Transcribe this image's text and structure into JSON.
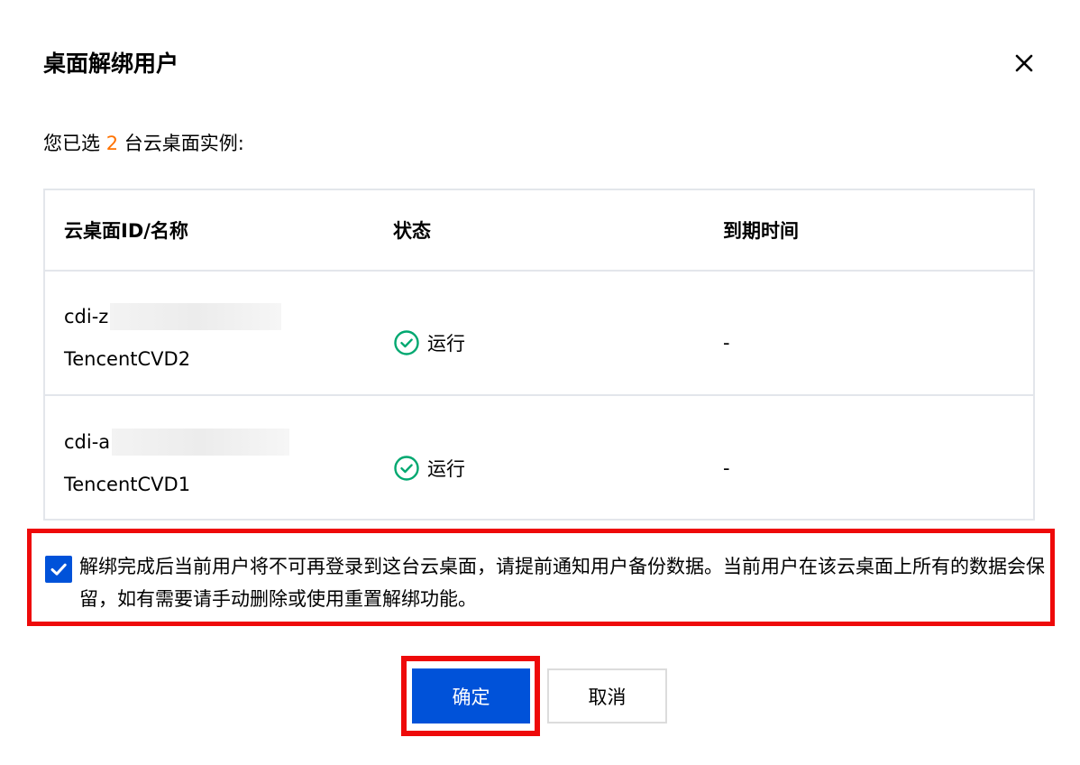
{
  "dialog": {
    "title": "桌面解绑用户",
    "close_icon": "close-icon"
  },
  "summary": {
    "prefix": "您已选 ",
    "count": "2",
    "suffix": " 台云桌面实例:",
    "count_color": "#ff7200"
  },
  "table": {
    "columns": [
      "云桌面ID/名称",
      "状态",
      "到期时间"
    ],
    "rows": [
      {
        "id_prefix": "cdi-z",
        "name": "TencentCVD2",
        "status": "运行",
        "status_icon": "check-circle-icon",
        "expire": "-"
      },
      {
        "id_prefix": "cdi-a",
        "name": "TencentCVD1",
        "status": "运行",
        "status_icon": "check-circle-icon",
        "expire": "-"
      }
    ]
  },
  "confirmation": {
    "checked": true,
    "text": "解绑完成后当前用户将不可再登录到这台云桌面，请提前通知用户备份数据。当前用户在该云桌面上所有的数据会保留，如有需要请手动删除或使用重置解绑功能。"
  },
  "buttons": {
    "ok_label": "确定",
    "cancel_label": "取消"
  },
  "colors": {
    "primary": "#0052d9",
    "success": "#00a870",
    "highlight": "#ee0a0a",
    "accent": "#ff7200"
  }
}
